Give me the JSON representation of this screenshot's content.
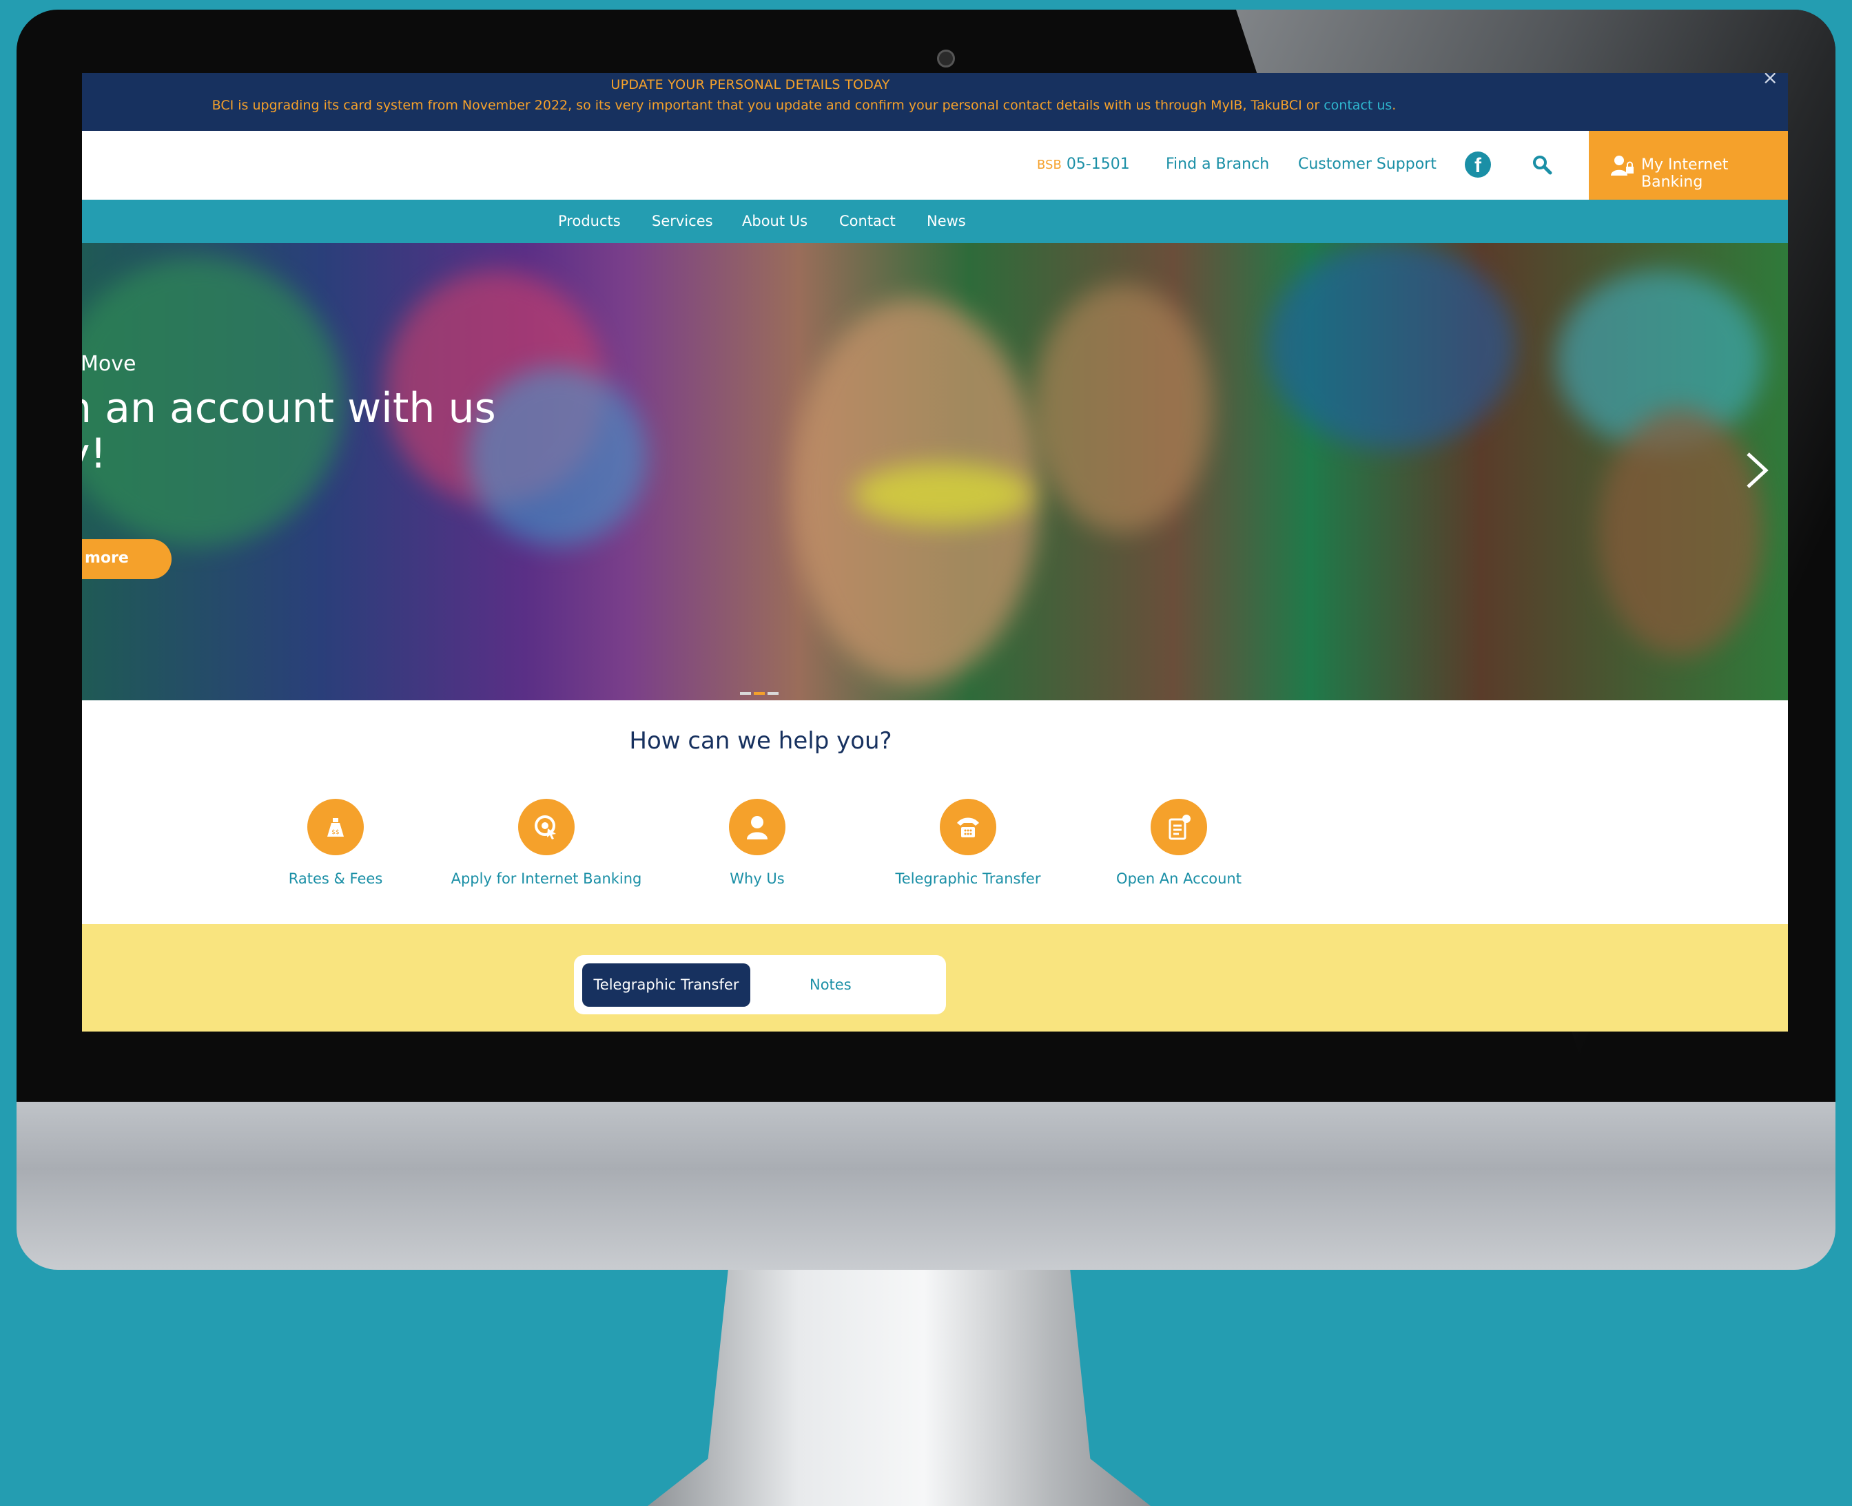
{
  "notice": {
    "title": "UPDATE YOUR PERSONAL DETAILS TODAY",
    "text": "BCI is upgrading its card system from November 2022, so its very important that you update and confirm your personal contact details with us through MyIB, TakuBCI or ",
    "link": "contact us",
    "tail": ".",
    "close_icon": "close-icon"
  },
  "topbar": {
    "bsb_label": "BSB",
    "bsb_number": "05-1501",
    "find_branch": "Find a Branch",
    "customer_support": "Customer Support",
    "social_icon": "facebook-icon",
    "search_icon": "search-icon",
    "ib_button": "My Internet Banking"
  },
  "nav": [
    "Products",
    "Services",
    "About Us",
    "Contact",
    "News"
  ],
  "hero": {
    "subtitle": "Move",
    "title": "n an account with us\ny!",
    "button": "more",
    "next_icon": "chevron-right-icon",
    "slides": 3,
    "active_slide": 2
  },
  "help": {
    "title": "How can we help you?",
    "tiles": [
      {
        "label": "Rates & Fees",
        "icon": "money-bag-icon"
      },
      {
        "label": "Apply for Internet Banking",
        "icon": "click-icon"
      },
      {
        "label": "Why Us",
        "icon": "person-icon"
      },
      {
        "label": "Telegraphic Transfer",
        "icon": "phone-icon"
      },
      {
        "label": "Open An Account",
        "icon": "clipboard-icon"
      }
    ]
  },
  "tabs": {
    "active": "Telegraphic Transfer",
    "other": "Notes"
  },
  "colors": {
    "navy": "#17315f",
    "teal": "#249db1",
    "orange": "#f5a12b",
    "yellow": "#f9e47f"
  }
}
